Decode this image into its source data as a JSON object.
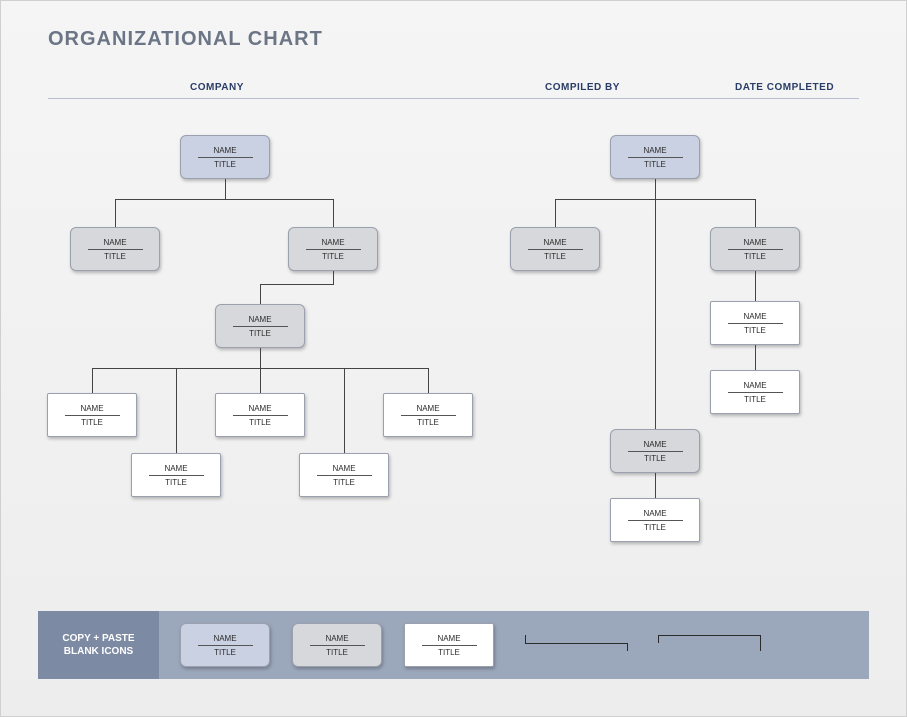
{
  "title": "ORGANIZATIONAL CHART",
  "headers": {
    "company": "COMPANY",
    "compiled_by": "COMPILED BY",
    "date_completed": "DATE COMPLETED"
  },
  "labels": {
    "name": "NAME",
    "title": "TITLE"
  },
  "footer": {
    "copy_paste": "COPY + PASTE BLANK ICONS"
  },
  "chart_data": {
    "type": "org-chart",
    "left_tree": {
      "root": {
        "name": "NAME",
        "title": "TITLE",
        "style": "blue"
      },
      "children": [
        {
          "name": "NAME",
          "title": "TITLE",
          "style": "grey"
        },
        {
          "name": "NAME",
          "title": "TITLE",
          "style": "grey",
          "children": [
            {
              "name": "NAME",
              "title": "TITLE",
              "style": "grey",
              "children_layout": "five-staggered",
              "children": [
                {
                  "name": "NAME",
                  "title": "TITLE",
                  "style": "white"
                },
                {
                  "name": "NAME",
                  "title": "TITLE",
                  "style": "white"
                },
                {
                  "name": "NAME",
                  "title": "TITLE",
                  "style": "white"
                },
                {
                  "name": "NAME",
                  "title": "TITLE",
                  "style": "white"
                },
                {
                  "name": "NAME",
                  "title": "TITLE",
                  "style": "white"
                }
              ]
            }
          ]
        }
      ]
    },
    "right_tree": {
      "root": {
        "name": "NAME",
        "title": "TITLE",
        "style": "blue"
      },
      "children": [
        {
          "name": "NAME",
          "title": "TITLE",
          "style": "grey"
        },
        {
          "name": "NAME",
          "title": "TITLE",
          "style": "grey",
          "children_layout": "vertical-chain",
          "children": [
            {
              "name": "NAME",
              "title": "TITLE",
              "style": "white"
            },
            {
              "name": "NAME",
              "title": "TITLE",
              "style": "white"
            },
            {
              "name": "NAME",
              "title": "TITLE",
              "style": "grey",
              "children": [
                {
                  "name": "NAME",
                  "title": "TITLE",
                  "style": "white"
                }
              ]
            }
          ]
        }
      ]
    },
    "legend": [
      {
        "style": "blue"
      },
      {
        "style": "grey"
      },
      {
        "style": "white"
      }
    ]
  }
}
